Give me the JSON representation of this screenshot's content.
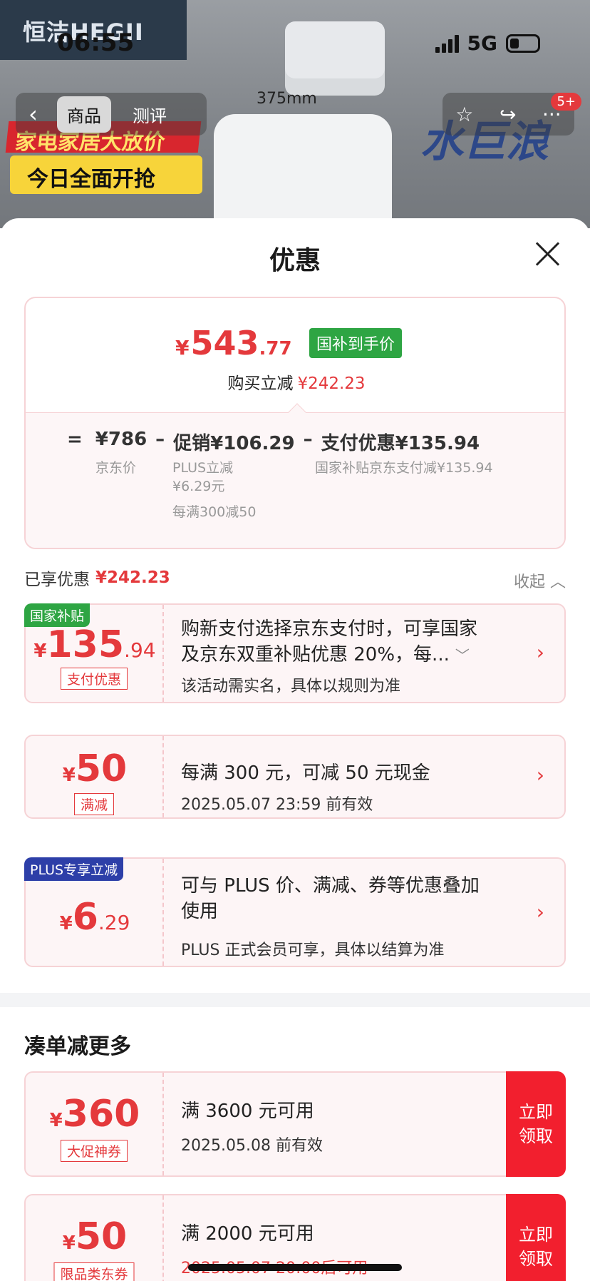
{
  "background": {
    "brand": "恒洁HEGII",
    "dimension": "375mm",
    "promo_line1": "家电家居大放价",
    "promo_line2": "今日全面开抢",
    "logo_text": "水巨浪"
  },
  "status_bar": {
    "time": "06:55",
    "network": "5G"
  },
  "nav": {
    "tab_product": "商品",
    "tab_review": "测评",
    "cart_badge": "5+"
  },
  "sheet": {
    "title": "优惠"
  },
  "price": {
    "yen": "¥",
    "integer": "543",
    "decimal": ".77",
    "tag": "国补到手价",
    "instant_label": "购买立减",
    "instant_amount": "¥242.23",
    "calc_eq": "=",
    "jd_price": "¥786",
    "minus1": "–",
    "promo": "促销¥106.29",
    "minus2": "–",
    "pay": "支付优惠¥135.94",
    "jd_price_label": "京东价",
    "promo_sub1": "PLUS立减",
    "promo_sub2": "¥6.29元",
    "promo_sub3": "每满300减50",
    "pay_sub": "国家补贴京东支付减¥135.94"
  },
  "enjoyed": {
    "label": "已享优惠",
    "amount": "¥242.23",
    "collapse": "收起"
  },
  "coupons": [
    {
      "corner": "国家补贴",
      "yen": "¥",
      "big": "135",
      "small": ".94",
      "tag": "支付优惠",
      "line1": "购新支付选择京东支付时，可享国家",
      "line2": "及京东双重补贴优惠 20%，每...",
      "sub": "该活动需实名，具体以规则为准"
    },
    {
      "yen": "¥",
      "big": "50",
      "tag": "满减",
      "line1": "每满 300 元，可减 50 元现金",
      "sub": "2025.05.07 23:59 前有效"
    },
    {
      "corner": "PLUS专享立减",
      "yen": "¥",
      "big": "6",
      "small": ".29",
      "line1": "可与 PLUS 价、满减、券等优惠叠加",
      "line2": "使用",
      "sub": "PLUS 正式会员可享，具体以结算为准"
    }
  ],
  "more": {
    "title": "凑单减更多",
    "items": [
      {
        "yen": "¥",
        "big": "360",
        "tag": "大促神券",
        "line1": "满 3600 元可用",
        "sub": "2025.05.08 前有效",
        "button1": "立即",
        "button2": "领取"
      },
      {
        "yen": "¥",
        "big": "50",
        "tag": "限品类东券",
        "line1": "满 2000 元可用",
        "sub": "2025.05.07 20:00后可用",
        "button1": "立即",
        "button2": "领取"
      }
    ]
  },
  "colors": {
    "accent": "#e4393c",
    "gov_green": "#2ea543",
    "plus_blue": "#2d3fa8",
    "claim_red": "#f21f2e"
  }
}
